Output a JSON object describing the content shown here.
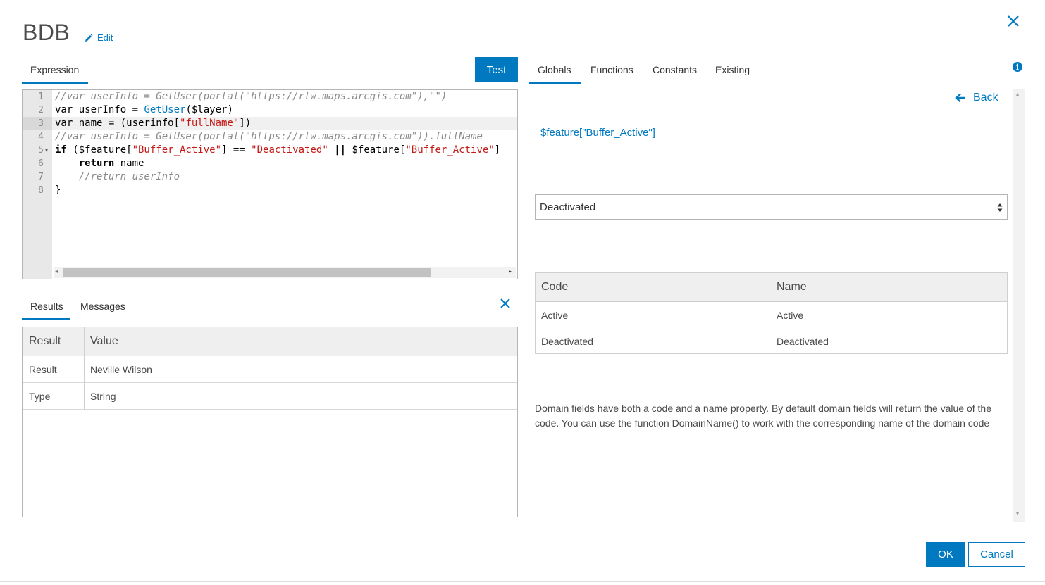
{
  "header": {
    "title": "BDB",
    "edit_label": "Edit"
  },
  "editor": {
    "tab_label": "Expression",
    "test_button": "Test",
    "line_numbers": [
      "1",
      "2",
      "3",
      "4",
      "5",
      "6",
      "7",
      "8"
    ]
  },
  "results_panel": {
    "tabs": [
      "Results",
      "Messages"
    ],
    "columns": [
      "Result",
      "Value"
    ],
    "rows": [
      {
        "result": "Result",
        "value": "Neville Wilson"
      },
      {
        "result": "Type",
        "value": "String"
      }
    ]
  },
  "right_panel": {
    "tabs": [
      "Globals",
      "Functions",
      "Constants",
      "Existing"
    ],
    "back_label": "Back",
    "feature_label": "$feature[\"Buffer_Active\"]",
    "selected_value": "Deactivated",
    "domain_columns": [
      "Code",
      "Name"
    ],
    "domain_rows": [
      {
        "code": "Active",
        "name": "Active"
      },
      {
        "code": "Deactivated",
        "name": "Deactivated"
      }
    ],
    "description": "Domain fields have both a code and a name property. By default domain fields will return the value of the code. You can use the function DomainName() to work with the corresponding name of the domain code"
  },
  "footer": {
    "ok_label": "OK",
    "cancel_label": "Cancel"
  },
  "colors": {
    "accent": "#0079c1",
    "string": "#c41a16",
    "comment": "#8a8a8a"
  }
}
